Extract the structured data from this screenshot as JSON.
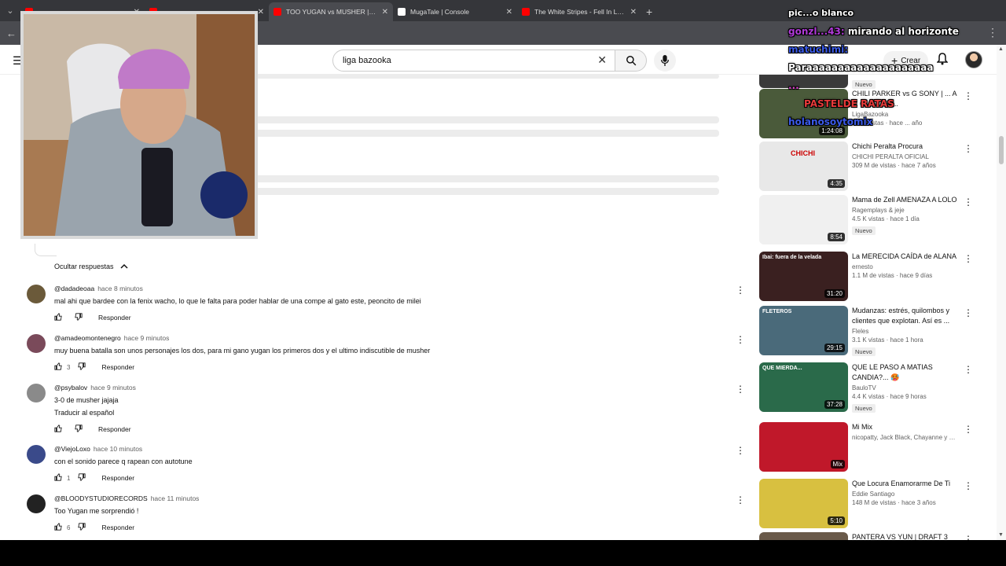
{
  "browser": {
    "tabs": [
      {
        "title": "...",
        "fav": "#f00",
        "active": false
      },
      {
        "title": "...",
        "fav": "#f00",
        "active": false
      },
      {
        "title": "TOO YUGAN vs MUSHER | #LIG",
        "fav": "#ff0000",
        "active": true
      },
      {
        "title": "MugaTale | Console",
        "fav": "#ffffff",
        "active": false
      },
      {
        "title": "The White Stripes - Fell In Love",
        "fav": "#ff0000",
        "active": false
      }
    ]
  },
  "header": {
    "search_value": "liga bazooka",
    "create_label": "Crear"
  },
  "comments": {
    "hide_replies_label": "Ocultar respuestas",
    "items": [
      {
        "author": "@dadadeoaa",
        "time": "hace 8 minutos",
        "text": "mal ahi que bardee con la fenix wacho, lo que le falta para poder hablar de una compe al gato este, peoncito de milei",
        "likes": "",
        "reply": "Responder",
        "avatar": "#6b5a3a"
      },
      {
        "author": "@amadeomontenegro",
        "time": "hace 9 minutos",
        "text": "muy buena batalla son unos personajes los dos, para mi gano yugan los primeros dos y el ultimo indiscutible de musher",
        "likes": "3",
        "reply": "Responder",
        "avatar": "#7a4a5a"
      },
      {
        "author": "@psybalov",
        "time": "hace 9 minutos",
        "text": "3-0 de musher jajaja",
        "text2": "Traducir al español",
        "likes": "",
        "reply": "Responder",
        "avatar": "#8a8a8a"
      },
      {
        "author": "@ViejoLoxo",
        "time": "hace 10 minutos",
        "text": "con el sonido parece q rapean con autotune",
        "likes": "1",
        "reply": "Responder",
        "avatar": "#3a4a8a"
      },
      {
        "author": "@BLOODYSTUDIORECORDS",
        "time": "hace 11 minutos",
        "text": "Too Yugan me sorprendió !",
        "likes": "6",
        "reply": "Responder",
        "avatar": "#222222"
      }
    ]
  },
  "sidebar": {
    "videos": [
      {
        "title": "",
        "channel": "",
        "meta": "",
        "badge": "Nuevo",
        "duration": "",
        "thumb": "#3a3a3a",
        "partial": true
      },
      {
        "title": "CHILI PARKER vs G SONY | ... A ... OVISTAR ...",
        "channel": "LigaBazooka",
        "meta": "... de vistas · hace ... año",
        "badge": "",
        "duration": "1:24:08",
        "thumb": "#4a5a3a"
      },
      {
        "title": "Chichi Peralta Procura",
        "channel": "CHICHI PERALTA OFICIAL",
        "meta": "309 M de vistas · hace 7 años",
        "badge": "",
        "duration": "4:35",
        "thumb": "#e8e8e8",
        "thumbtext": "CHICHI"
      },
      {
        "title": "Mama de Zell AMENAZA A LOLO",
        "channel": "Ragemplays & jeje",
        "meta": "4.5 K vistas · hace 1 día",
        "badge": "Nuevo",
        "duration": "8:54",
        "thumb": "#f0f0f0"
      },
      {
        "title": "La MERECIDA CAÍDA de ALANA",
        "channel": "ernesto",
        "meta": "1.1 M de vistas · hace 9 días",
        "badge": "",
        "duration": "31:20",
        "thumb": "#3a2020",
        "thumbtext": "Ibai: fuera de la velada"
      },
      {
        "title": "Mudanzas: estrés, quilombos y clientes que explotan. Así es ...",
        "channel": "Fleles",
        "meta": "3.1 K vistas · hace 1 hora",
        "badge": "Nuevo",
        "duration": "29:15",
        "thumb": "#4a6a7a",
        "thumbtext": "FLETEROS"
      },
      {
        "title": "QUE LE PASO A MATIAS CANDIA?... 🥵",
        "channel": "BauloTV",
        "meta": "4.4 K vistas · hace 9 horas",
        "badge": "Nuevo",
        "duration": "37:28",
        "thumb": "#2a6a4a",
        "thumbtext": "QUE MIERDA..."
      },
      {
        "title": "Mi Mix",
        "channel": "nicopatty, Jack Black, Chayanne y much...",
        "meta": "",
        "badge": "",
        "duration": "Mix",
        "thumb": "#c0182a"
      },
      {
        "title": "Que Locura Enamorarme De Ti",
        "channel": "Eddie Santiago",
        "meta": "148 M de vistas · hace 3 años",
        "badge": "",
        "duration": "5:10",
        "thumb": "#d8c040"
      },
      {
        "title": "PANTERA VS YUN | DRAFT 3",
        "channel": "",
        "meta": "",
        "badge": "",
        "duration": "",
        "thumb": "#6a5a4a"
      }
    ]
  },
  "chat": {
    "lines": [
      {
        "text": "pic...o blanco",
        "color": "#ffffff"
      },
      {
        "text": "gonzl...43:",
        "color": "#b03ad8",
        "msg": "mirando al horizonte"
      },
      {
        "text": "matuchimi:",
        "color": "#3a5ae8"
      },
      {
        "text": "Paraaaaaaaaaaaaaaaaaaaa",
        "color": "#ffffff"
      },
      {
        "text": "...",
        "color": "#e84ad8"
      },
      {
        "text": "PASTELDE RATAS",
        "color": "#e83a3a"
      },
      {
        "text": "holanosoytomix",
        "color": "#3a5ae8"
      }
    ]
  },
  "colors": {
    "yt_red": "#ff0000",
    "chrome_dark": "#35363a"
  }
}
